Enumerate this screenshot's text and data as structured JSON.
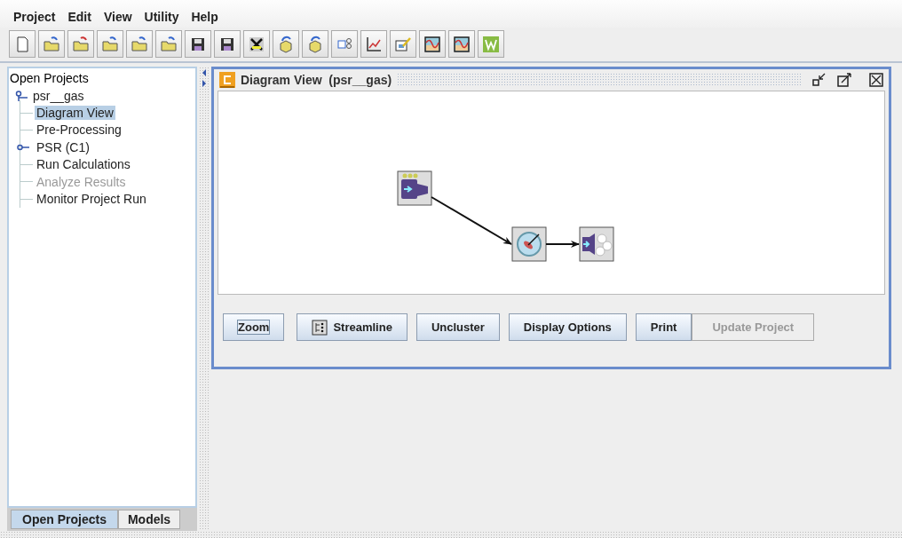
{
  "menu": [
    "Project",
    "Edit",
    "View",
    "Utility",
    "Help"
  ],
  "sidebar": {
    "tree": {
      "label": "Open Projects",
      "children": [
        {
          "label": "psr__gas",
          "expanded": true,
          "selected": false,
          "disabled": false,
          "children": [
            {
              "label": "Diagram View",
              "selected": true,
              "disabled": false
            },
            {
              "label": "Pre-Processing",
              "selected": false,
              "disabled": false
            },
            {
              "label": "PSR (C1)",
              "expanded": false,
              "selected": false,
              "disabled": false
            },
            {
              "label": "Run Calculations",
              "selected": false,
              "disabled": false
            },
            {
              "label": "Analyze Results",
              "selected": false,
              "disabled": true
            },
            {
              "label": "Monitor Project Run",
              "selected": false,
              "disabled": false
            }
          ]
        }
      ]
    },
    "tabs": [
      {
        "label": "Open Projects",
        "selected": true
      },
      {
        "label": "Models",
        "selected": false
      }
    ]
  },
  "frame": {
    "title": "Diagram View  (psr__gas)",
    "buttons": [
      {
        "label": "Zoom",
        "focused": true,
        "disabled": false,
        "kind": "plain"
      },
      {
        "label": "Streamline",
        "focused": false,
        "disabled": false,
        "kind": "icon"
      },
      {
        "label": "Uncluster",
        "focused": false,
        "disabled": false,
        "kind": "plain"
      },
      {
        "label": "Display Options",
        "focused": false,
        "disabled": false,
        "kind": "plain"
      },
      {
        "label": "Print",
        "focused": false,
        "disabled": false,
        "kind": "plain"
      },
      {
        "label": "Update Project",
        "focused": false,
        "disabled": true,
        "kind": "plain"
      }
    ]
  }
}
